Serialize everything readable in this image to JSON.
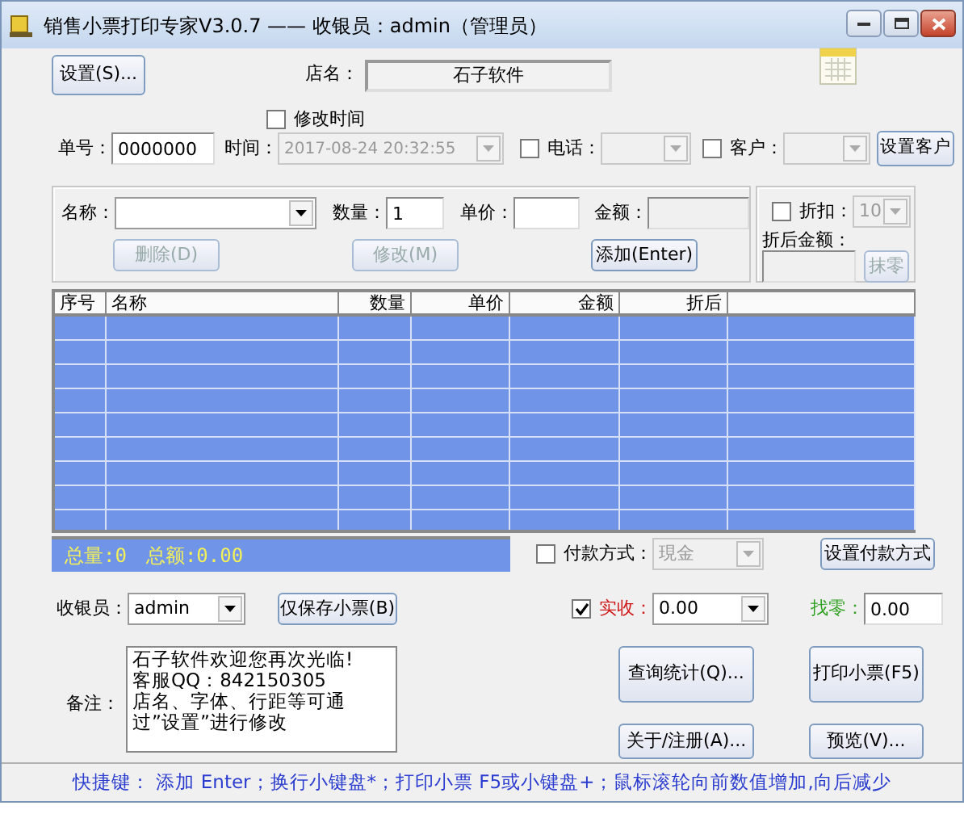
{
  "window": {
    "title": "销售小票打印专家V3.0.7 —— 收银员：admin（管理员）"
  },
  "header": {
    "settings_button": "设置(S)...",
    "shop_name_label": "店名：",
    "shop_name": "石子软件"
  },
  "order": {
    "modify_time": {
      "label": "修改时间",
      "checked": false
    },
    "number_label": "单号：",
    "number": "0000000",
    "time_label": "时间：",
    "time": "2017-08-24 20:32:55",
    "time_disabled": true,
    "phone": {
      "label": "电话：",
      "checked": false,
      "disabled": true
    },
    "customer": {
      "label": "客户：",
      "checked": false,
      "disabled": true
    },
    "set_customer_button": "设置客户"
  },
  "item": {
    "name_label": "名称：",
    "quantity_label": "数量：",
    "quantity": "1",
    "price_label": "单价：",
    "amount_label": "金额：",
    "amount_disabled": true,
    "buttons": [
      {
        "label": "删除(D)",
        "disabled": true
      },
      {
        "label": "修改(M)",
        "disabled": true
      },
      {
        "label": "添加(Enter)",
        "disabled": false
      }
    ]
  },
  "discount": {
    "label": "折扣：",
    "checked": false,
    "value": "10",
    "disabled": true,
    "after_label": "折后金额：",
    "round_button": {
      "label": "抹零",
      "disabled": true
    }
  },
  "table": {
    "columns": [
      "序号",
      "名称",
      "数量",
      "单价",
      "金额",
      "折后"
    ]
  },
  "summary": {
    "total_quantity": "总量:0",
    "total_amount": "总额:0.00"
  },
  "payment": {
    "label": "付款方式：",
    "checked": false,
    "value": "現金",
    "disabled": true,
    "button": "设置付款方式"
  },
  "cashier": {
    "label": "收银员：",
    "value": "admin",
    "save_button": "仅保存小票(B)"
  },
  "received": {
    "label": "实收：",
    "checked": true,
    "value": "0.00"
  },
  "change": {
    "label": "找零：",
    "value": "0.00"
  },
  "notes": {
    "label": "备注：",
    "text": "石子软件欢迎您再次光临!\n客服QQ：842150305\n店名、字体、行距等可通过”设置”进行修改"
  },
  "actions": [
    {
      "label": "查询统计(Q)..."
    },
    {
      "label": "打印小票(F5)"
    },
    {
      "label": "关于/注册(A)..."
    },
    {
      "label": "预览(V)..."
    }
  ],
  "status_bar": "快捷键：  添加 Enter；换行小键盘*；打印小票 F5或小键盘+；鼠标滚轮向前数值增加,向后减少"
}
